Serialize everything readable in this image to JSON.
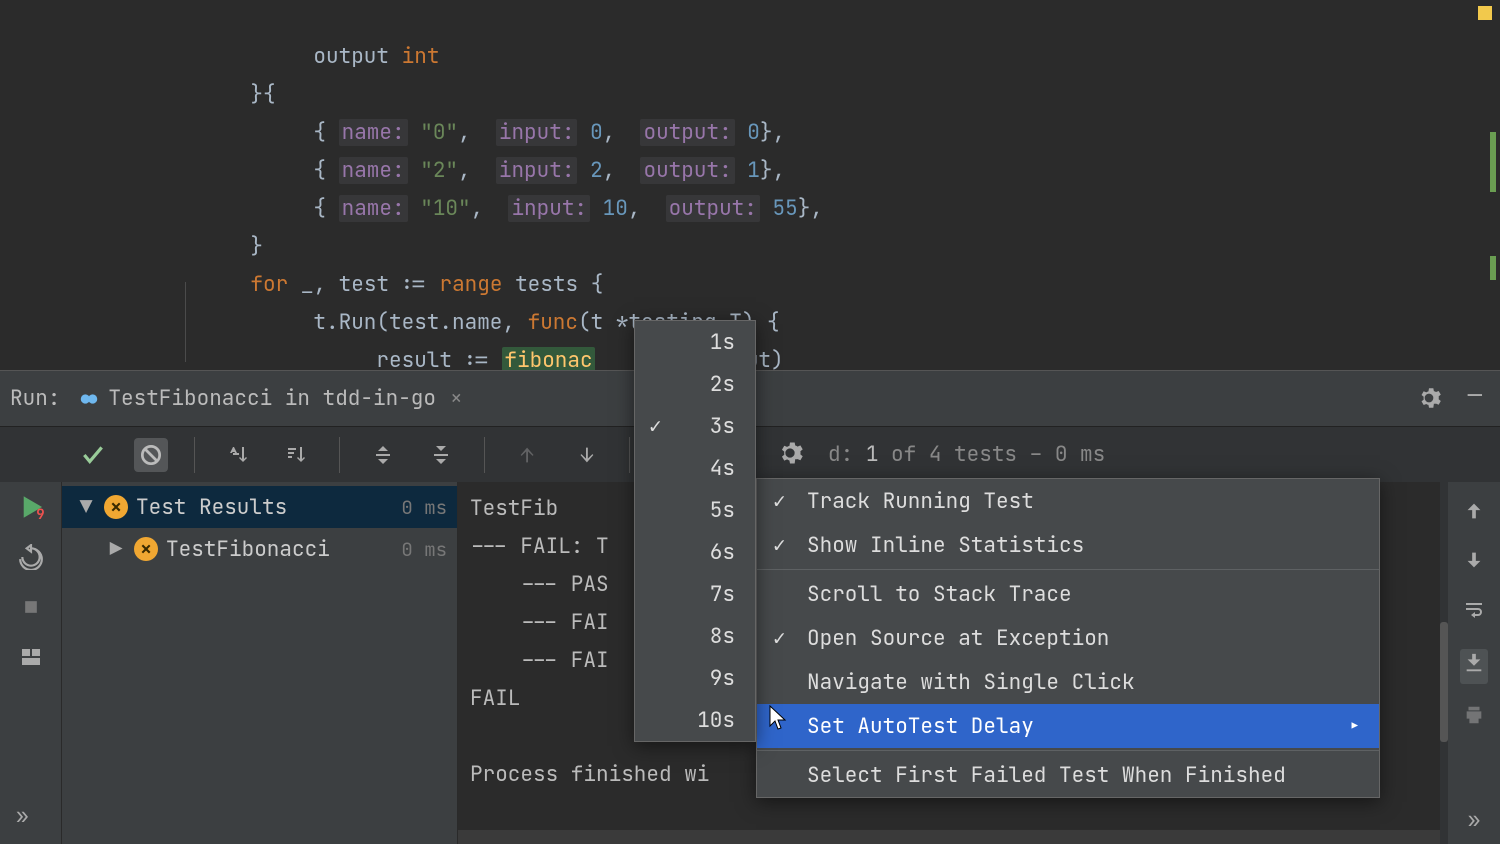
{
  "code": {
    "field_output": "output",
    "type_int": "int",
    "row0_name": "name:",
    "row0_name_v": "\"0\"",
    "row_input": "input:",
    "row_output": "output:",
    "row0_in": "0",
    "row0_out": "0",
    "row1_name_v": "\"2\"",
    "row1_in": "2",
    "row1_out": "1",
    "row2_name_v": "\"10\"",
    "row2_in": "10",
    "row2_out": "55",
    "for_kw": "for",
    "blank": "_",
    "test_id": "test",
    "assign": ":=",
    "range_kw": "range",
    "tests_id": "tests",
    "t_run": "t.Run(test.name, ",
    "func_kw": "func",
    "func_sig1": "(t *testing.T) {",
    "result_line_pre": "result := ",
    "fib_fn": "fibonac",
    "result_line_post": "input)"
  },
  "run": {
    "label": "Run:",
    "config": "TestFibonacci in tdd-in-go",
    "close": "×"
  },
  "summary": {
    "prefix": "d: ",
    "failed": "1",
    "rest": " of 4 tests – 0 ms"
  },
  "tree": {
    "root_label": "Test Results",
    "root_ms": "0 ms",
    "child_label": "TestFibonacci",
    "child_ms": "0 ms"
  },
  "console": {
    "l1": "TestFib",
    "l2": "--- FAIL: T",
    "l3": "    --- PAS",
    "l4": "    --- FAI",
    "l5": "    --- FAI",
    "l6": "FAIL",
    "l7": "",
    "l8": "Process finished wi"
  },
  "settings_menu": {
    "track": "Track Running Test",
    "inline": "Show Inline Statistics",
    "scroll": "Scroll to Stack Trace",
    "opensrc": "Open Source at Exception",
    "navigate": "Navigate with Single Click",
    "autotest": "Set AutoTest Delay",
    "selectfirst": "Select First Failed Test When Finished"
  },
  "delay_menu": {
    "items": [
      "1s",
      "2s",
      "3s",
      "4s",
      "5s",
      "6s",
      "7s",
      "8s",
      "9s",
      "10s"
    ],
    "checked": "3s"
  }
}
